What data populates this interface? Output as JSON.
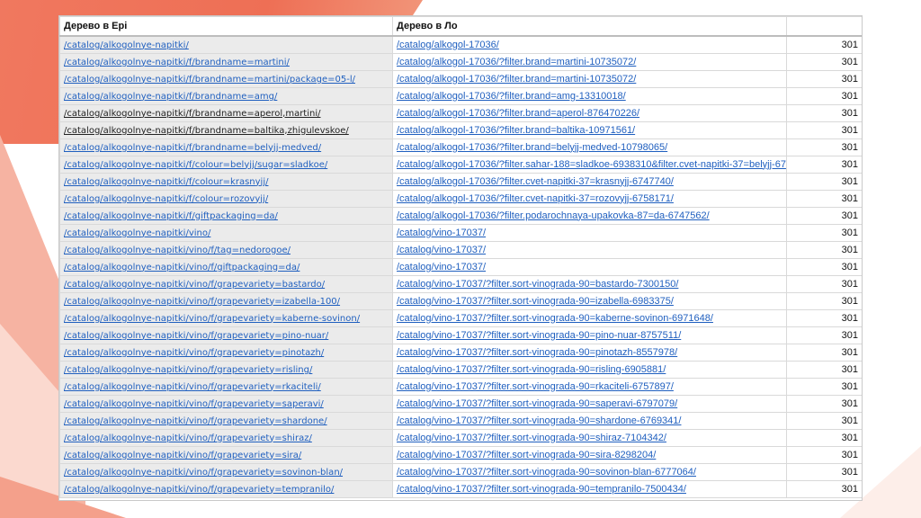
{
  "table": {
    "headers": [
      "Дерево в Ері",
      "Дерево в Ло",
      ""
    ],
    "rows": [
      {
        "old": "/catalog/alkogolnye-napitki/",
        "new": "/catalog/alkogol-17036/",
        "code": "301"
      },
      {
        "old": "/catalog/alkogolnye-napitki/f/brandname=martini/",
        "new": "/catalog/alkogol-17036/?filter.brand=martini-10735072/",
        "code": "301"
      },
      {
        "old": "/catalog/alkogolnye-napitki/f/brandname=martini/package=05-l/",
        "new": "/catalog/alkogol-17036/?filter.brand=martini-10735072/",
        "code": "301"
      },
      {
        "old": "/catalog/alkogolnye-napitki/f/brandname=amg/",
        "new": "/catalog/alkogol-17036/?filter.brand=amg-13310018/",
        "code": "301"
      },
      {
        "old": "/catalog/alkogolnye-napitki/f/brandname=aperol,martini/",
        "new": "/catalog/alkogol-17036/?filter.brand=aperol-876470226/",
        "code": "301"
      },
      {
        "old": "/catalog/alkogolnye-napitki/f/brandname=baltika,zhigulevskoe/",
        "new": "/catalog/alkogol-17036/?filter.brand=baltika-10971561/",
        "code": "301"
      },
      {
        "old": "/catalog/alkogolnye-napitki/f/brandname=belyjj-medved/",
        "new": "/catalog/alkogol-17036/?filter.brand=belyjj-medved-10798065/",
        "code": "301"
      },
      {
        "old": "/catalog/alkogolnye-napitki/f/colour=belyjj/sugar=sladkoe/",
        "new": "/catalog/alkogol-17036/?filter.sahar-188=sladkoe-6938310&filter.cvet-napitki-37=belyjj-67",
        "code": "301"
      },
      {
        "old": "/catalog/alkogolnye-napitki/f/colour=krasnyjj/",
        "new": "/catalog/alkogol-17036/?filter.cvet-napitki-37=krasnyjj-6747740/",
        "code": "301"
      },
      {
        "old": "/catalog/alkogolnye-napitki/f/colour=rozovyjj/",
        "new": "/catalog/alkogol-17036/?filter.cvet-napitki-37=rozovyjj-6758171/",
        "code": "301"
      },
      {
        "old": "/catalog/alkogolnye-napitki/f/giftpackaging=da/",
        "new": "/catalog/alkogol-17036/?filter.podarochnaya-upakovka-87=da-6747562/",
        "code": "301"
      },
      {
        "old": "/catalog/alkogolnye-napitki/vino/",
        "new": "/catalog/vino-17037/",
        "code": "301"
      },
      {
        "old": "/catalog/alkogolnye-napitki/vino/f/tag=nedorogoe/",
        "new": "/catalog/vino-17037/",
        "code": "301"
      },
      {
        "old": "/catalog/alkogolnye-napitki/vino/f/giftpackaging=da/",
        "new": "/catalog/vino-17037/",
        "code": "301"
      },
      {
        "old": "/catalog/alkogolnye-napitki/vino/f/grapevariety=bastardo/",
        "new": "/catalog/vino-17037/?filter.sort-vinograda-90=bastardo-7300150/",
        "code": "301"
      },
      {
        "old": "/catalog/alkogolnye-napitki/vino/f/grapevariety=izabella-100/",
        "new": "/catalog/vino-17037/?filter.sort-vinograda-90=izabella-6983375/",
        "code": "301"
      },
      {
        "old": "/catalog/alkogolnye-napitki/vino/f/grapevariety=kaberne-sovinon/",
        "new": "/catalog/vino-17037/?filter.sort-vinograda-90=kaberne-sovinon-6971648/",
        "code": "301"
      },
      {
        "old": "/catalog/alkogolnye-napitki/vino/f/grapevariety=pino-nuar/",
        "new": "/catalog/vino-17037/?filter.sort-vinograda-90=pino-nuar-8757511/",
        "code": "301"
      },
      {
        "old": "/catalog/alkogolnye-napitki/vino/f/grapevariety=pinotazh/",
        "new": "/catalog/vino-17037/?filter.sort-vinograda-90=pinotazh-8557978/",
        "code": "301"
      },
      {
        "old": "/catalog/alkogolnye-napitki/vino/f/grapevariety=risling/",
        "new": "/catalog/vino-17037/?filter.sort-vinograda-90=risling-6905881/",
        "code": "301"
      },
      {
        "old": "/catalog/alkogolnye-napitki/vino/f/grapevariety=rkaciteli/",
        "new": "/catalog/vino-17037/?filter.sort-vinograda-90=rkaciteli-6757897/",
        "code": "301"
      },
      {
        "old": "/catalog/alkogolnye-napitki/vino/f/grapevariety=saperavi/",
        "new": "/catalog/vino-17037/?filter.sort-vinograda-90=saperavi-6797079/",
        "code": "301"
      },
      {
        "old": "/catalog/alkogolnye-napitki/vino/f/grapevariety=shardone/",
        "new": "/catalog/vino-17037/?filter.sort-vinograda-90=shardone-6769341/",
        "code": "301"
      },
      {
        "old": "/catalog/alkogolnye-napitki/vino/f/grapevariety=shiraz/",
        "new": "/catalog/vino-17037/?filter.sort-vinograda-90=shiraz-7104342/",
        "code": "301"
      },
      {
        "old": "/catalog/alkogolnye-napitki/vino/f/grapevariety=sira/",
        "new": "/catalog/vino-17037/?filter.sort-vinograda-90=sira-8298204/",
        "code": "301"
      },
      {
        "old": "/catalog/alkogolnye-napitki/vino/f/grapevariety=sovinon-blan/",
        "new": "/catalog/vino-17037/?filter.sort-vinograda-90=sovinon-blan-6777064/",
        "code": "301"
      },
      {
        "old": "/catalog/alkogolnye-napitki/vino/f/grapevariety=tempranilo/",
        "new": "/catalog/vino-17037/?filter.sort-vinograda-90=tempranilo-7500434/",
        "code": "301"
      }
    ],
    "dark_rows": [
      4,
      5
    ]
  }
}
